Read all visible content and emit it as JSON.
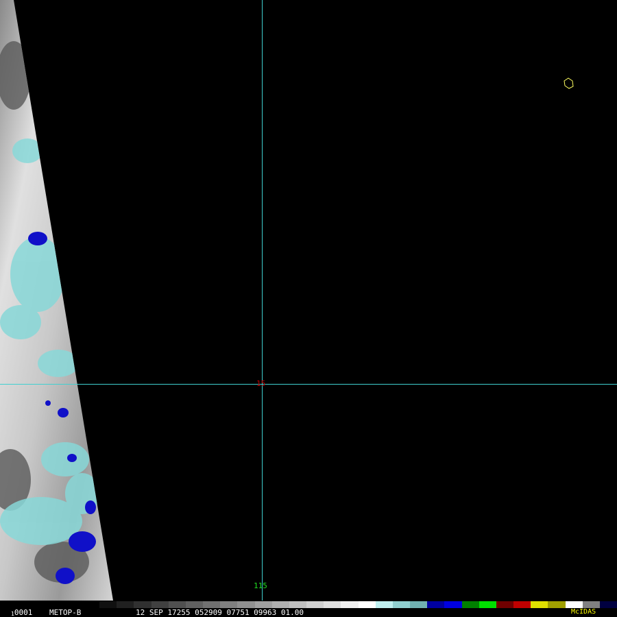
{
  "imagery": {
    "latitude_label": "15",
    "longitude_label": "115"
  },
  "status_bar": {
    "frame_prefix": "1",
    "frame_number": "0001",
    "satellite": "METOP-B",
    "datetime_line": "12 SEP 17255 052909 07751 09963 01.00",
    "software": "McIDAS"
  },
  "colors": {
    "grid": "#40d0d0",
    "latitude_label": "#c00000",
    "longitude_label": "#20e020",
    "coastline": "#ffff60",
    "software_label": "#ffff00"
  },
  "enhancement_scale": [
    "#101010",
    "#202020",
    "#303030",
    "#404040",
    "#505050",
    "#606060",
    "#707070",
    "#808080",
    "#909090",
    "#a0a0a0",
    "#b0b0b0",
    "#c0c0c0",
    "#d0d0d0",
    "#e0e0e0",
    "#f0f0f0",
    "#ffffff",
    "#c0f0f0",
    "#90d0d0",
    "#70b0b0",
    "#0000a0",
    "#0000e0",
    "#008000",
    "#00e000",
    "#700000",
    "#c00000",
    "#e0e000",
    "#a0a000",
    "#ffffff",
    "#808080",
    "#000040"
  ]
}
